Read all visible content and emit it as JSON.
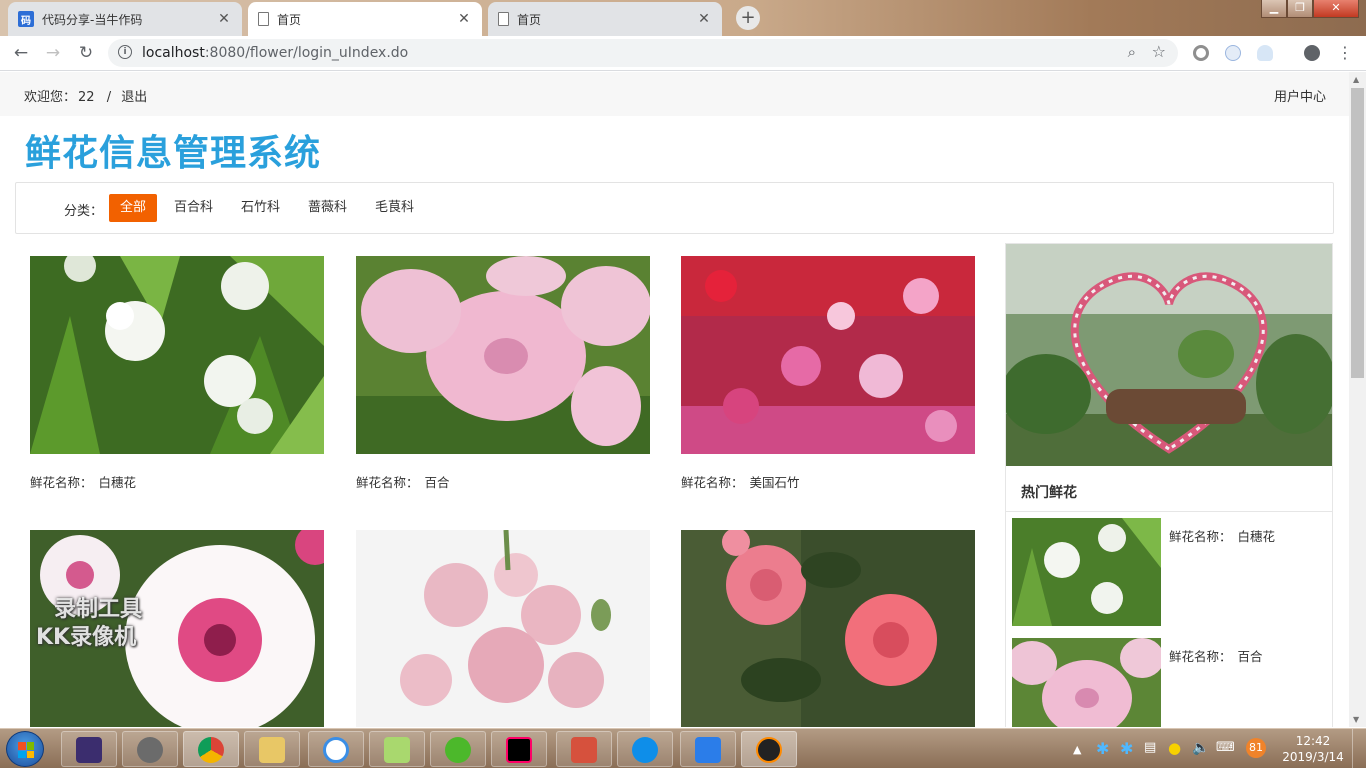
{
  "browser": {
    "tabs": [
      {
        "title": "代码分享-当牛作码",
        "favicon": "code-share-favicon",
        "favicon_text": "码",
        "active": false
      },
      {
        "title": "首页",
        "favicon": "document-icon",
        "active": true
      },
      {
        "title": "首页",
        "favicon": "document-icon",
        "active": false
      }
    ],
    "new_tab": "+",
    "url_host": "localhost",
    "url_path": ":8080/flower/login_uIndex.do"
  },
  "page": {
    "welcome_prefix": "欢迎您：",
    "username": "22",
    "separator": "/",
    "logout": "退出",
    "user_center": "用户中心",
    "brand": "鲜花信息管理系统",
    "category_label": "分类：",
    "categories": [
      {
        "label": "全部",
        "active": true
      },
      {
        "label": "百合科",
        "active": false
      },
      {
        "label": "石竹科",
        "active": false
      },
      {
        "label": "蔷薇科",
        "active": false
      },
      {
        "label": "毛茛科",
        "active": false
      }
    ],
    "name_label": "鲜花名称：",
    "flowers": [
      {
        "name": "白穗花"
      },
      {
        "name": "百合"
      },
      {
        "name": "美国石竹"
      },
      {
        "name": ""
      },
      {
        "name": ""
      },
      {
        "name": ""
      }
    ],
    "hot_title": "热门鲜花",
    "hot": [
      {
        "name": "白穗花"
      },
      {
        "name": "百合"
      }
    ],
    "watermark_line1": "录制工具",
    "watermark_line2": "KK录像机"
  },
  "taskbar": {
    "time": "12:42",
    "date": "2019/3/14",
    "badge": "81",
    "apps": [
      "java-ee-ide",
      "media-player",
      "chrome",
      "file-explorer",
      "baidu-netdisk",
      "notepad-plus",
      "green-app",
      "intellij-idea",
      "paint-tool",
      "teamviewer",
      "wps",
      "kk-recorder"
    ]
  },
  "colors": {
    "brand": "#2aa0dc",
    "active_category": "#f26100"
  }
}
